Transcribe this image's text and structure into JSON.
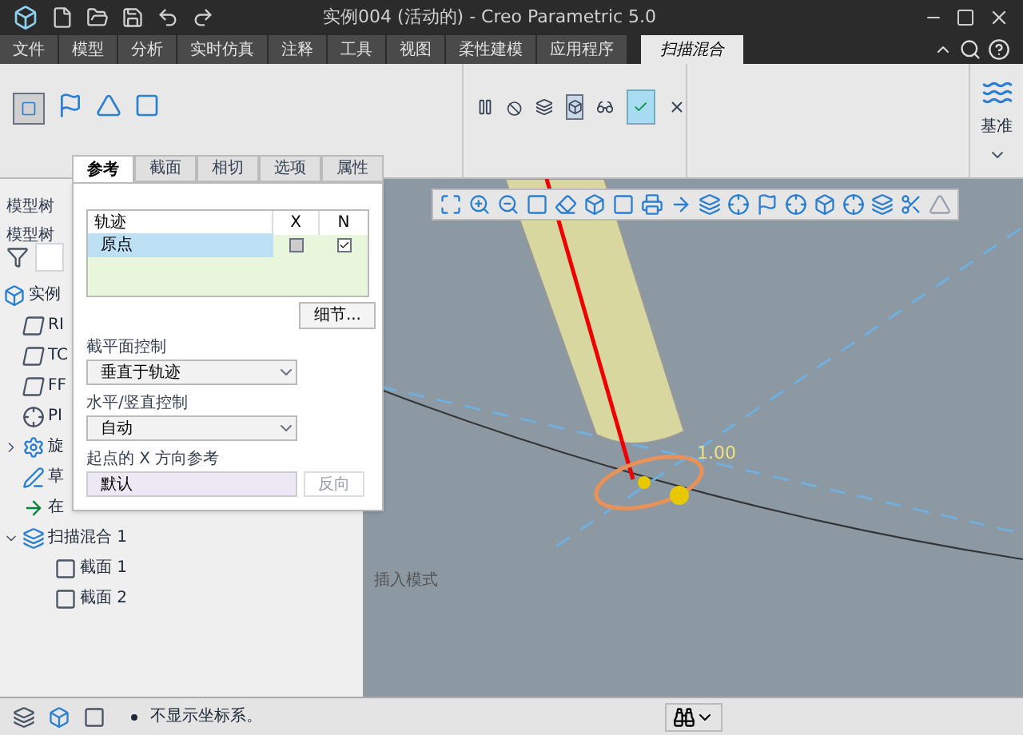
{
  "window": {
    "title": "实例004 (活动的) - Creo Parametric 5.0"
  },
  "tabs": [
    {
      "label": "文件",
      "selected": false
    },
    {
      "label": "模型",
      "selected": false
    },
    {
      "label": "分析",
      "selected": false
    },
    {
      "label": "实时仿真",
      "selected": false
    },
    {
      "label": "注释",
      "selected": false
    },
    {
      "label": "工具",
      "selected": false
    },
    {
      "label": "视图",
      "selected": false
    },
    {
      "label": "柔性建模",
      "selected": false
    },
    {
      "label": "应用程序",
      "selected": false
    },
    {
      "label": "扫描混合",
      "selected": true
    }
  ],
  "ribbon": {
    "datum_label": "基准"
  },
  "model_tree": {
    "header": "模型树",
    "subheader": "模型树",
    "items": [
      {
        "label": "实例",
        "kind": "part"
      },
      {
        "label": "RI",
        "kind": "plane"
      },
      {
        "label": "TC",
        "kind": "plane"
      },
      {
        "label": "FF",
        "kind": "plane"
      },
      {
        "label": "PI",
        "kind": "csys"
      },
      {
        "label": "旋",
        "kind": "revolve",
        "expanded": false
      },
      {
        "label": "草",
        "kind": "sketch"
      },
      {
        "label": "在",
        "kind": "insert"
      },
      {
        "label": "扫描混合 1",
        "kind": "sweep",
        "expanded": true,
        "children": [
          {
            "label": "截面 1",
            "kind": "section"
          },
          {
            "label": "截面 2",
            "kind": "section"
          }
        ]
      }
    ]
  },
  "panel": {
    "tabs": [
      {
        "label": "参考",
        "selected": true
      },
      {
        "label": "截面",
        "selected": false
      },
      {
        "label": "相切",
        "selected": false
      },
      {
        "label": "选项",
        "selected": false
      },
      {
        "label": "属性",
        "selected": false
      }
    ],
    "table": {
      "columns": [
        "轨迹",
        "X",
        "N"
      ],
      "rows": [
        {
          "name": "原点",
          "x": false,
          "n": true,
          "selected": true
        }
      ]
    },
    "details_button": "细节...",
    "section_plane_label": "截平面控制",
    "section_plane_value": "垂直于轨迹",
    "orientation_label": "水平/竖直控制",
    "orientation_value": "自动",
    "x_ref_label": "起点的 X 方向参考",
    "x_ref_value": "默认",
    "flip_button": {
      "label": "反向",
      "disabled": true
    }
  },
  "viewport": {
    "dimension": "1.00",
    "mode_label": "插入模式"
  },
  "status_bar": {
    "message": "不显示坐标系。"
  }
}
